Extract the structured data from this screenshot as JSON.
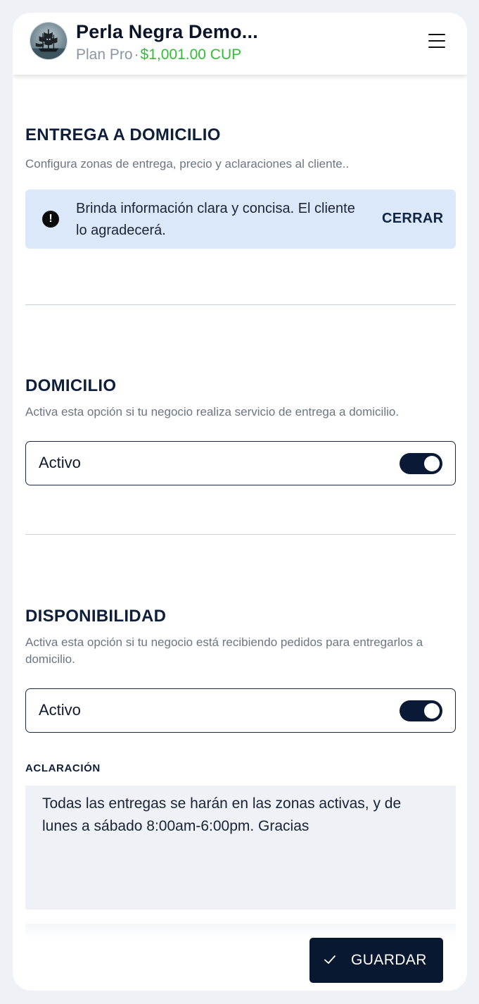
{
  "header": {
    "business_name": "Perla Negra Demo...",
    "plan": "Plan Pro",
    "separator": "·",
    "balance": "$1,001.00 CUP",
    "avatar_icon": "pirate-ship-icon",
    "menu_icon": "hamburger-menu-icon"
  },
  "delivery": {
    "title": "ENTREGA A DOMICILIO",
    "description": "Configura zonas de entrega, precio y aclaraciones al cliente..",
    "alert": {
      "icon": "exclamation-circle-icon",
      "message": "Brinda información clara y concisa. El cliente lo agradecerá.",
      "close_label": "CERRAR"
    }
  },
  "home_service": {
    "title": "DOMICILIO",
    "description": "Activa esta opción si tu negocio realiza servicio de entrega a domicilio.",
    "toggle_label": "Activo",
    "enabled": true
  },
  "availability": {
    "title": "DISPONIBILIDAD",
    "description": "Activa esta opción si tu negocio está recibiendo pedidos para entregarlos a domicilio.",
    "toggle_label": "Activo",
    "enabled": true
  },
  "clarification": {
    "label": "ACLARACIÓN",
    "value": "Todas las entregas se harán en las zonas activas, y de lunes a sábado 8:00am-6:00pm. Gracias"
  },
  "footer": {
    "save_label": "GUARDAR",
    "save_icon": "check-icon"
  },
  "colors": {
    "primary": "#081830",
    "accent_green": "#2fbf35",
    "alert_bg": "#dbe8fa"
  }
}
